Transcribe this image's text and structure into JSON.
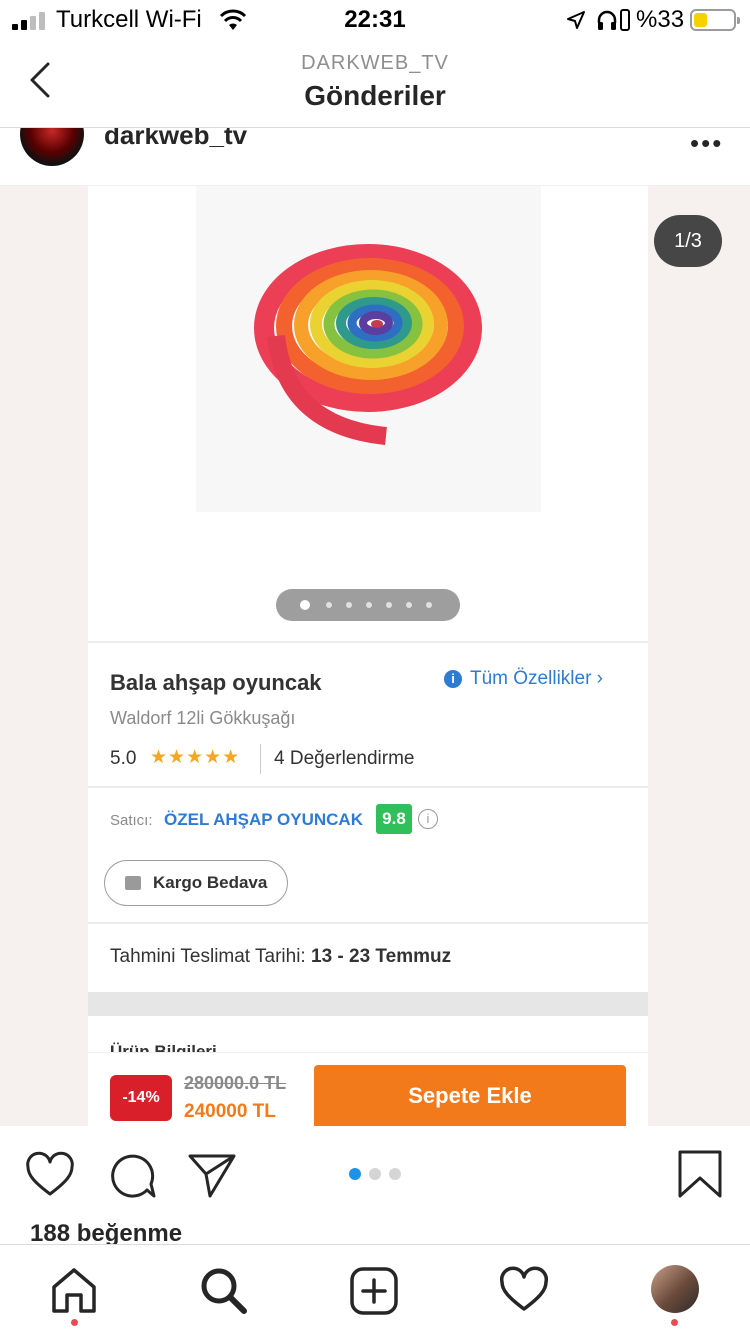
{
  "status_bar": {
    "carrier": "Turkcell Wi-Fi",
    "time": "22:31",
    "battery_percent": "%33",
    "battery_level": 0.33
  },
  "nav": {
    "subtitle": "DARKWEB_TV",
    "title": "Gönderiler"
  },
  "post": {
    "username": "darkweb_tv",
    "more": "•••",
    "counter": "1/3",
    "likes": "188 beğenme"
  },
  "product": {
    "title": "Bala ahşap oyuncak",
    "subtitle": "Waldorf 12li Gökkuşağı",
    "all_features": "Tüm Özellikler",
    "rating": "5.0",
    "stars": "★★★★★",
    "reviews": "4 Değerlendirme",
    "seller_label": "Satıcı:",
    "seller_name": "ÖZEL AHŞAP OYUNCAK",
    "seller_score": "9.8",
    "shipping": "Kargo Bedava",
    "delivery_label": "Tahmini Teslimat Tarihi:",
    "delivery_dates": "13 - 23 Temmuz",
    "info_heading": "Ürün Bilgileri",
    "discount": "-14%",
    "old_price": "280000.0 TL",
    "new_price": "240000 TL",
    "add_to_cart": "Sepete Ekle"
  },
  "colors": {
    "accent_blue": "#2f7bd3",
    "orange": "#f27a1a",
    "discount_red": "#d9202a",
    "score_green": "#2fbf5b",
    "dot_active": "#1d92e6",
    "notification_red": "#ed4956"
  },
  "icons": {
    "back": "chevron-left-icon",
    "like": "heart-icon",
    "comment": "comment-icon",
    "share": "paper-plane-icon",
    "save": "bookmark-icon",
    "home": "home-icon",
    "search": "search-icon",
    "new_post": "plus-square-icon",
    "activity": "heart-icon"
  }
}
